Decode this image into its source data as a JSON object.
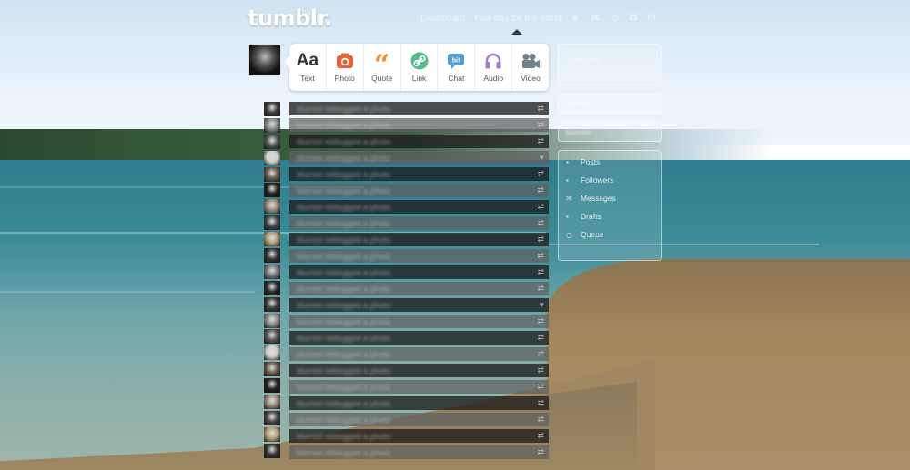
{
  "header": {
    "logo": "tumblr.",
    "nav_links": [
      "Dashboard",
      "Your day for the world"
    ],
    "icons": [
      "home-icon",
      "mail-icon",
      "people-icon",
      "gear-icon",
      "power-icon"
    ]
  },
  "post_bar": {
    "buttons": [
      {
        "label": "Text",
        "icon": "text-icon",
        "color": "#333333"
      },
      {
        "label": "Photo",
        "icon": "camera-icon",
        "color": "#e8603c"
      },
      {
        "label": "Quote",
        "icon": "quote-icon",
        "color": "#f28a2e"
      },
      {
        "label": "Link",
        "icon": "link-icon",
        "color": "#56bc8a"
      },
      {
        "label": "Chat",
        "icon": "chat-icon",
        "color": "#529ecc"
      },
      {
        "label": "Audio",
        "icon": "headphones-icon",
        "color": "#a77dc2"
      },
      {
        "label": "Video",
        "icon": "video-camera-icon",
        "color": "#748089"
      }
    ]
  },
  "feed": {
    "rows": [
      {
        "text": "blurred reblogged a photo",
        "icon": "reblog-icon"
      },
      {
        "text": "blurred reblogged a photo",
        "icon": "reblog-icon"
      },
      {
        "text": "blurred reblogged a photo",
        "icon": "reblog-icon"
      },
      {
        "text": "blurred reblogged a photo",
        "icon": "heart-icon"
      },
      {
        "text": "blurred reblogged a photo",
        "icon": "reblog-icon"
      },
      {
        "text": "blurred reblogged a photo",
        "icon": "reblog-icon"
      },
      {
        "text": "blurred reblogged a photo",
        "icon": "reblog-icon"
      },
      {
        "text": "blurred reblogged a photo",
        "icon": "reblog-icon"
      },
      {
        "text": "blurred reblogged a photo",
        "icon": "reblog-icon"
      },
      {
        "text": "blurred reblogged a photo",
        "icon": "reblog-icon"
      },
      {
        "text": "blurred reblogged a photo",
        "icon": "reblog-icon"
      },
      {
        "text": "blurred reblogged a photo",
        "icon": "reblog-icon"
      },
      {
        "text": "blurred reblogged a photo",
        "icon": "heart-icon"
      },
      {
        "text": "blurred reblogged a photo",
        "icon": "reblog-icon"
      },
      {
        "text": "blurred reblogged a photo",
        "icon": "reblog-icon"
      },
      {
        "text": "blurred reblogged a photo",
        "icon": "reblog-icon"
      },
      {
        "text": "blurred reblogged a photo",
        "icon": "reblog-icon"
      },
      {
        "text": "blurred reblogged a photo",
        "icon": "reblog-icon"
      },
      {
        "text": "blurred reblogged a photo",
        "icon": "reblog-icon"
      },
      {
        "text": "blurred reblogged a photo",
        "icon": "reblog-icon"
      },
      {
        "text": "blurred reblogged a photo",
        "icon": "reblog-icon"
      },
      {
        "text": "blurred reblogged a photo",
        "icon": "reblog-icon"
      }
    ]
  },
  "sidebar": {
    "blog_name": "blurred",
    "blog_sub": "blurred",
    "box2": "blurred",
    "box3": "blurred",
    "menu": [
      {
        "label": "Posts",
        "icon": "posts-icon"
      },
      {
        "label": "Followers",
        "icon": "followers-icon"
      },
      {
        "label": "Messages",
        "icon": "messages-icon"
      },
      {
        "label": "Drafts",
        "icon": "drafts-icon"
      },
      {
        "label": "Queue",
        "icon": "queue-icon"
      }
    ]
  }
}
